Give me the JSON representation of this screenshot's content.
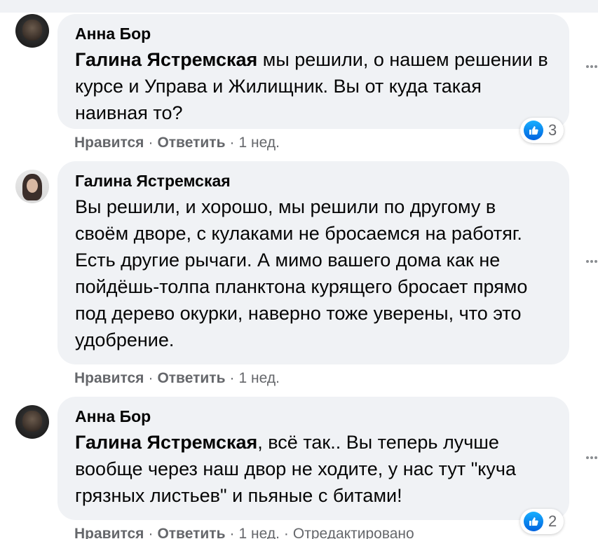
{
  "comments": [
    {
      "author": "Анна Бор",
      "mention": "Галина Ястремская",
      "text": " мы решили, о нашем решении в курсе и Управа и Жилищник. Вы от куда такая наивная то?",
      "like": "Нравится",
      "reply": "Ответить",
      "time": "1 нед.",
      "reaction_count": "3"
    },
    {
      "author": "Галина Ястремская",
      "text": "Вы решили, и хорошо, мы решили по другому в своём дворе, с кулаками не бросаемся на работяг. Есть другие рычаги. А мимо вашего дома как не пойдёшь-толпа планктона курящего бросает прямо под дерево окурки, наверно тоже уверены, что это удобрение.",
      "like": "Нравится",
      "reply": "Ответить",
      "time": "1 нед."
    },
    {
      "author": "Анна Бор",
      "mention": "Галина Ястремская",
      "text": ", всё так.. Вы теперь лучше вообще через наш двор не ходите, у нас тут \"куча грязных листьев\" и пьяные с битами!",
      "like": "Нравится",
      "reply": "Ответить",
      "time": "1 нед.",
      "edited": "Отредактировано",
      "reaction_count": "2"
    }
  ],
  "separator": "·",
  "icons": {
    "like": "thumbs-up-icon",
    "more": "more-options-icon"
  },
  "colors": {
    "bubble": "#f0f2f5",
    "meta_text": "#65676b",
    "like_blue": "#1877f2"
  }
}
